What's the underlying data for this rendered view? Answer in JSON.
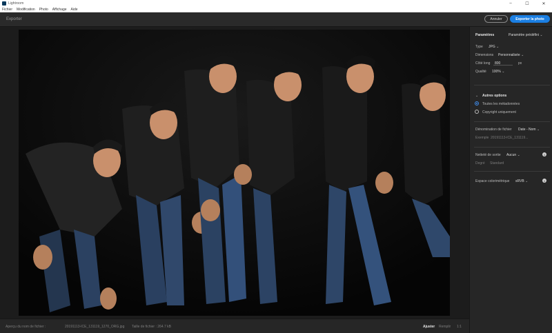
{
  "window": {
    "title": "Lightroom",
    "minimize": "–",
    "maximize": "☐",
    "close": "✕"
  },
  "menu": [
    "Fichier",
    "Modification",
    "Photo",
    "Affichage",
    "Aide"
  ],
  "header": {
    "title": "Exporter",
    "cancel_label": "Annuler",
    "export_label": "Exporter la photo",
    "accent": "#1b7fe3"
  },
  "footer": {
    "preview_label": "Aperçu du nom de fichier :",
    "filename": "20191113-ICE_131119_1270_ORG.jpg",
    "size_label": "Taille de fichier : 264.7 kB",
    "fit_label": "Ajuster",
    "fill_label": "Remplir",
    "ratio_label": "1:1"
  },
  "panel": {
    "section_title": "Paramètres",
    "preset": "Paramètre prédéfini",
    "type_label": "Type",
    "type_value": "JPG",
    "dimensions_label": "Dimensions",
    "dimensions_value": "Personnalisée",
    "long_side_label": "Côté long",
    "long_side_value": "800",
    "long_side_unit": "px",
    "quality_label": "Qualité",
    "quality_value": "100%",
    "more_options_title": "Autres options",
    "metadata_all": "Toutes les métadonnées",
    "metadata_copyright": "Copyright uniquement",
    "file_naming_label": "Dénomination de fichier",
    "file_naming_value": "Date - Nom",
    "example_label": "Exemple",
    "example_value": "20191113-ICE_131119...",
    "sharpen_label": "Netteté de sortie",
    "sharpen_value": "Aucun",
    "sharpen_for_label": "Degré",
    "sharpen_for_value": "Standard",
    "color_space_label": "Espace colorimétrique",
    "color_space_value": "sRVB"
  }
}
